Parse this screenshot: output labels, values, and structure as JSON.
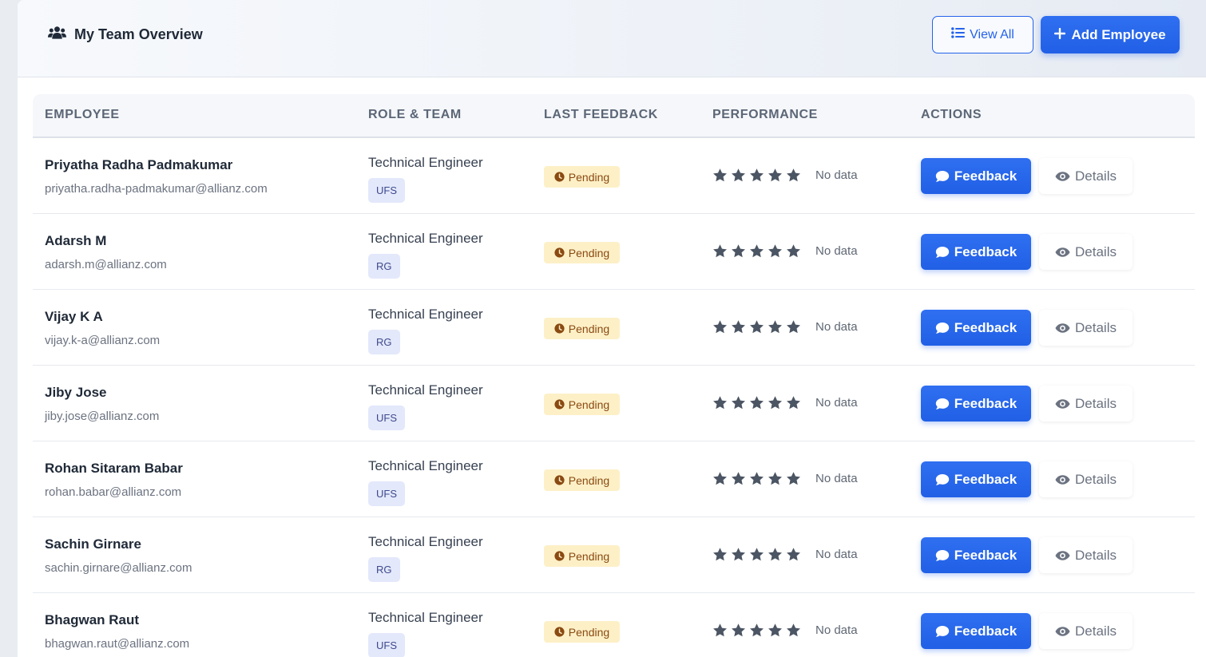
{
  "header": {
    "title": "My Team Overview",
    "icon": "users-icon",
    "view_all_label": "View All",
    "add_employee_label": "Add Employee"
  },
  "table": {
    "columns": [
      "EMPLOYEE",
      "ROLE & TEAM",
      "LAST FEEDBACK",
      "PERFORMANCE",
      "ACTIONS"
    ],
    "feedback_button_label": "Feedback",
    "details_button_label": "Details",
    "rows": [
      {
        "name": "Priyatha Radha Padmakumar",
        "email": "priyatha.radha-padmakumar@allianz.com",
        "role": "Technical Engineer",
        "team": "UFS",
        "status": "Pending",
        "rating": 0,
        "rating_text": "No data"
      },
      {
        "name": "Adarsh M",
        "email": "adarsh.m@allianz.com",
        "role": "Technical Engineer",
        "team": "RG",
        "status": "Pending",
        "rating": 0,
        "rating_text": "No data"
      },
      {
        "name": "Vijay K A",
        "email": "vijay.k-a@allianz.com",
        "role": "Technical Engineer",
        "team": "RG",
        "status": "Pending",
        "rating": 0,
        "rating_text": "No data"
      },
      {
        "name": "Jiby Jose",
        "email": "jiby.jose@allianz.com",
        "role": "Technical Engineer",
        "team": "UFS",
        "status": "Pending",
        "rating": 0,
        "rating_text": "No data"
      },
      {
        "name": "Rohan Sitaram Babar",
        "email": "rohan.babar@allianz.com",
        "role": "Technical Engineer",
        "team": "UFS",
        "status": "Pending",
        "rating": 0,
        "rating_text": "No data"
      },
      {
        "name": "Sachin Girnare",
        "email": "sachin.girnare@allianz.com",
        "role": "Technical Engineer",
        "team": "RG",
        "status": "Pending",
        "rating": 0,
        "rating_text": "No data"
      },
      {
        "name": "Bhagwan Raut",
        "email": "bhagwan.raut@allianz.com",
        "role": "Technical Engineer",
        "team": "UFS",
        "status": "Pending",
        "rating": 0,
        "rating_text": "No data"
      }
    ]
  },
  "colors": {
    "primary": "#2563eb",
    "pending_bg": "#fdf0c7",
    "pending_text": "#8a4a12",
    "team_badge_bg": "#e3e8fb",
    "star": "#4b5563"
  }
}
